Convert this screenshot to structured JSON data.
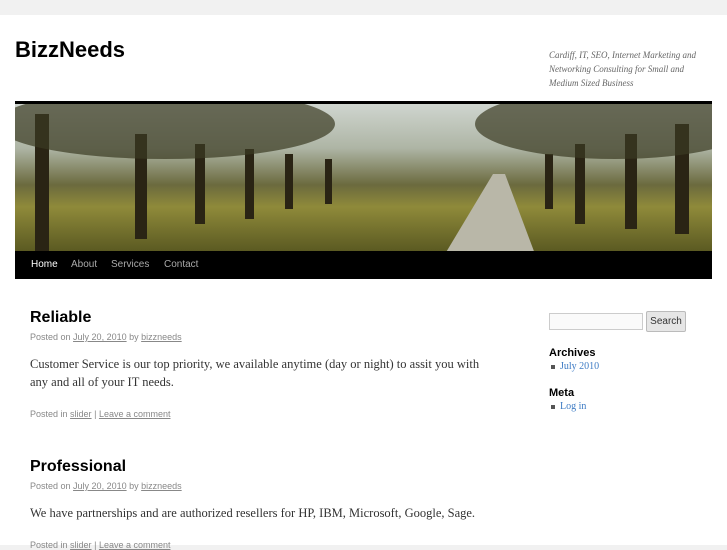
{
  "site": {
    "title": "BizzNeeds",
    "description": "Cardiff, IT, SEO, Internet Marketing and Networking Consulting for Small and Medium Sized Business"
  },
  "nav": [
    "Home",
    "About",
    "Services",
    "Contact"
  ],
  "posts": [
    {
      "title": "Reliable",
      "posted_on": "Posted on",
      "date": "July 20, 2010",
      "by": "by",
      "author": "bizzneeds",
      "body": "Customer Service is our top priority, we available anytime (day or night) to assit you with any and all of your IT needs.",
      "posted_in": "Posted in",
      "category": "slider",
      "sep": "|",
      "comment": "Leave a comment"
    },
    {
      "title": "Professional",
      "posted_on": "Posted on",
      "date": "July 20, 2010",
      "by": "by",
      "author": "bizzneeds",
      "body": "We have partnerships and are authorized resellers for HP, IBM, Microsoft, Google, Sage.",
      "posted_in": "Posted in",
      "category": "slider",
      "sep": "|",
      "comment": "Leave a comment"
    }
  ],
  "sidebar": {
    "search_button": "Search",
    "archives_title": "Archives",
    "archives": [
      "July 2010"
    ],
    "meta_title": "Meta",
    "meta": [
      "Log in"
    ]
  }
}
